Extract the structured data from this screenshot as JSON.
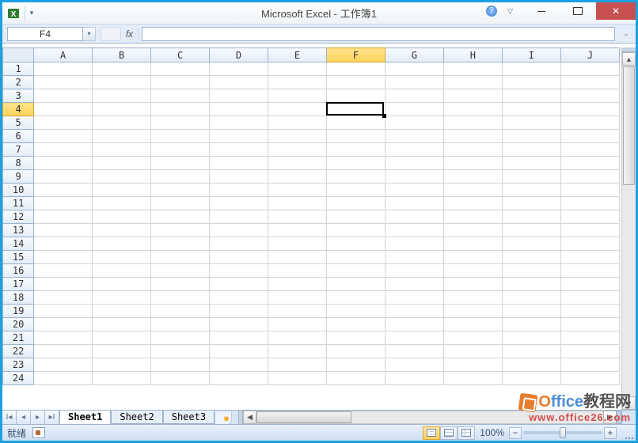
{
  "title": "Microsoft Excel - 工作簿1",
  "name_box": {
    "value": "F4"
  },
  "formula_bar": {
    "fx_label": "fx",
    "value": ""
  },
  "columns": [
    "A",
    "B",
    "C",
    "D",
    "E",
    "F",
    "G",
    "H",
    "I",
    "J"
  ],
  "rows": [
    1,
    2,
    3,
    4,
    5,
    6,
    7,
    8,
    9,
    10,
    11,
    12,
    13,
    14,
    15,
    16,
    17,
    18,
    19,
    20,
    21,
    22,
    23,
    24
  ],
  "active": {
    "col": "F",
    "row": 4,
    "col_index": 5,
    "row_index": 3
  },
  "sheets": {
    "tabs": [
      {
        "name": "Sheet1",
        "active": true
      },
      {
        "name": "Sheet2",
        "active": false
      },
      {
        "name": "Sheet3",
        "active": false
      }
    ]
  },
  "status": {
    "text": "就绪",
    "zoom": "100%"
  },
  "watermark": {
    "line1_a": "O",
    "line1_b": "ffice",
    "line1_c": "教程网",
    "line2": "www.office26.com"
  },
  "colors": {
    "accent": "#1ba1e2",
    "selected_header": "#ffd35a"
  }
}
